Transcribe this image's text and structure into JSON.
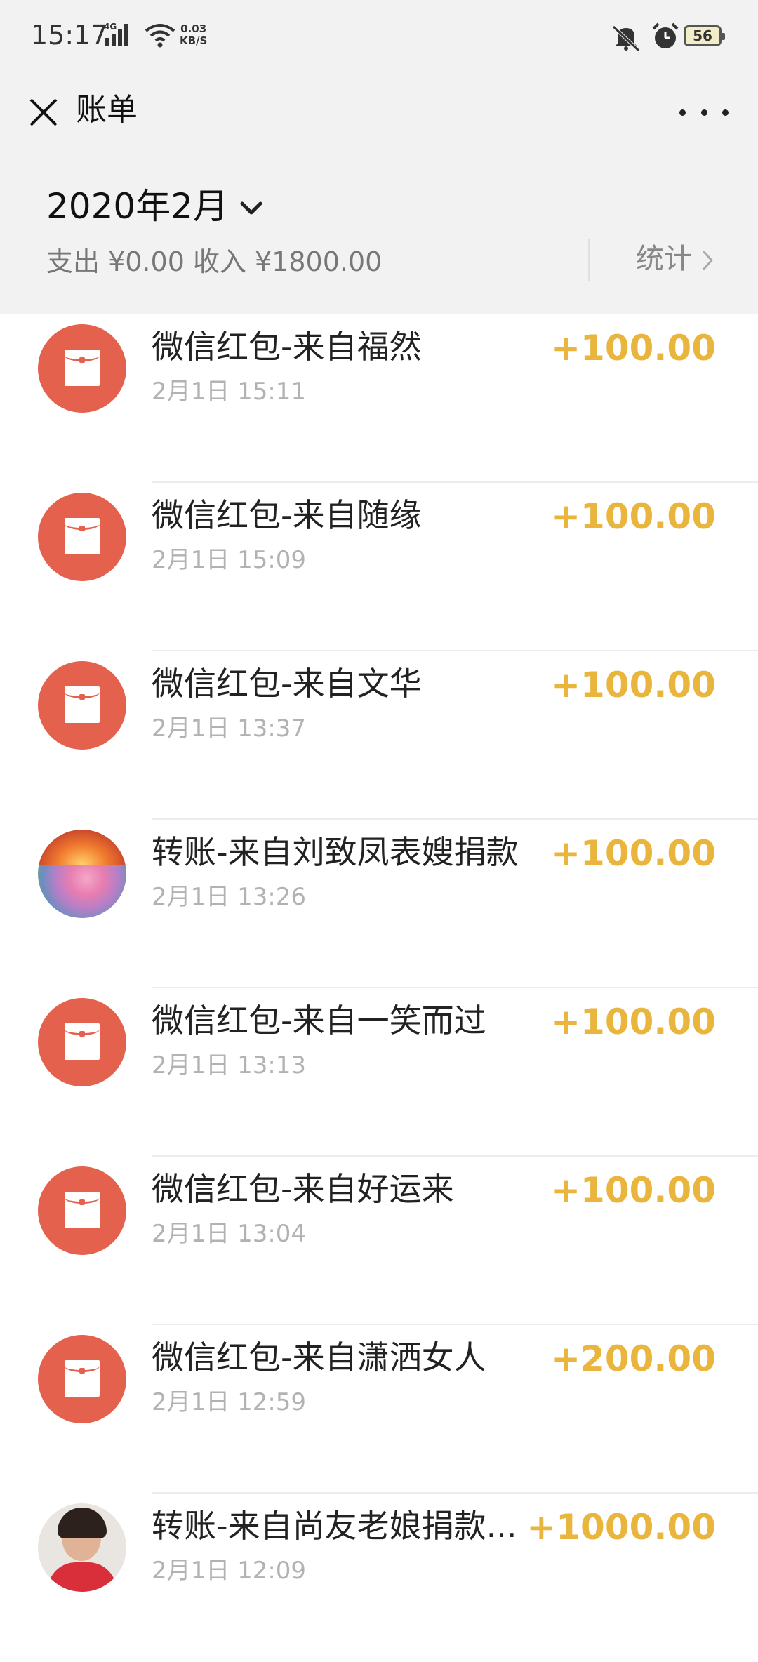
{
  "status_bar": {
    "time": "15:17",
    "network": "4G",
    "speed_value": "0.03",
    "speed_unit": "KB/S",
    "battery": "56"
  },
  "header": {
    "title": "账单"
  },
  "summary": {
    "month": "2020年2月",
    "totals": "支出 ¥0.00 收入 ¥1800.00",
    "stats_label": "统计"
  },
  "colors": {
    "amount": "#e9b53c",
    "red_packet": "#e4614e",
    "background": "#f2f2f2"
  },
  "transactions": [
    {
      "icon": "red-packet-icon",
      "title": "微信红包-来自福然",
      "time": "2月1日 15:11",
      "amount": "+100.00"
    },
    {
      "icon": "red-packet-icon",
      "title": "微信红包-来自随缘",
      "time": "2月1日 15:09",
      "amount": "+100.00"
    },
    {
      "icon": "red-packet-icon",
      "title": "微信红包-来自文华",
      "time": "2月1日 13:37",
      "amount": "+100.00"
    },
    {
      "icon": "user-avatar",
      "title": "转账-来自刘致凤表嫂捐款",
      "time": "2月1日 13:26",
      "amount": "+100.00"
    },
    {
      "icon": "red-packet-icon",
      "title": "微信红包-来自一笑而过",
      "time": "2月1日 13:13",
      "amount": "+100.00"
    },
    {
      "icon": "red-packet-icon",
      "title": "微信红包-来自好运来",
      "time": "2月1日 13:04",
      "amount": "+100.00"
    },
    {
      "icon": "red-packet-icon",
      "title": "微信红包-来自潇洒女人",
      "time": "2月1日 12:59",
      "amount": "+200.00"
    },
    {
      "icon": "user-avatar",
      "title": "转账-来自尚友老娘捐款...",
      "time": "2月1日 12:09",
      "amount": "+1000.00"
    }
  ]
}
